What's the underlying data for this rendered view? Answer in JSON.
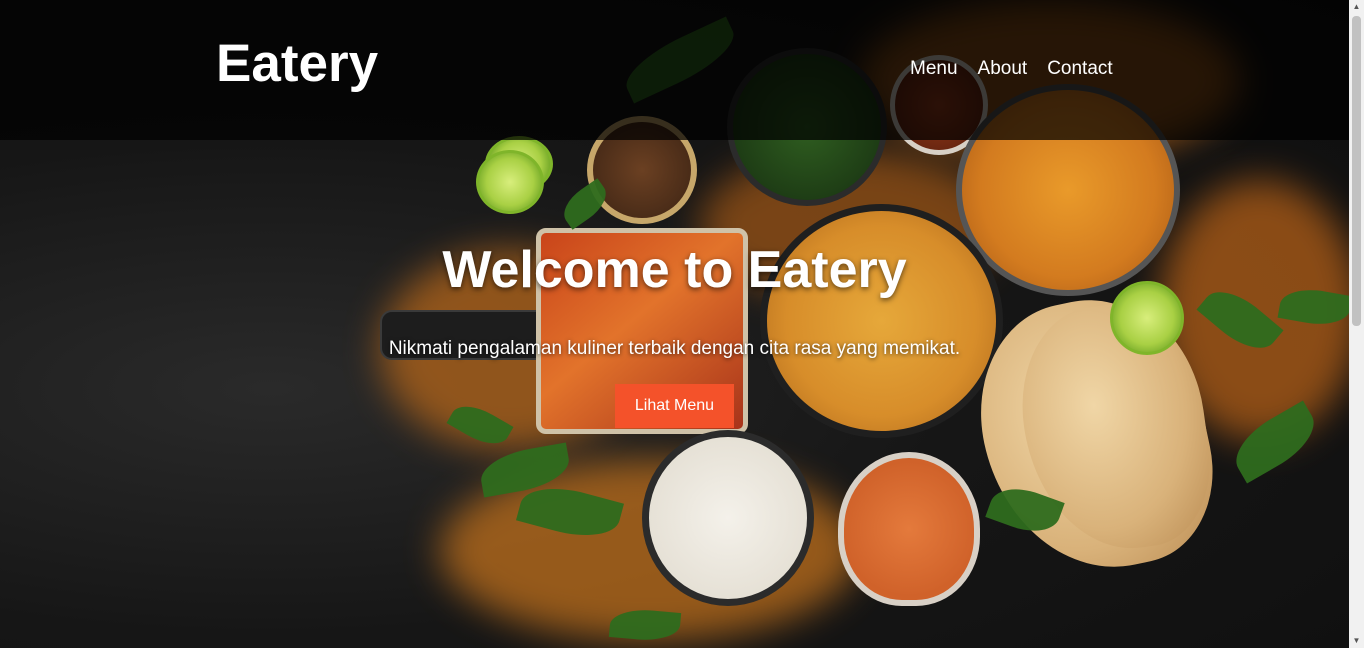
{
  "header": {
    "logo": "Eatery",
    "nav": [
      {
        "label": "Menu"
      },
      {
        "label": "About"
      },
      {
        "label": "Contact"
      }
    ]
  },
  "hero": {
    "title": "Welcome to Eatery",
    "subtitle": "Nikmati pengalaman kuliner terbaik dengan cita rasa yang memikat.",
    "cta_label": "Lihat Menu"
  },
  "colors": {
    "accent": "#f4522a",
    "header_overlay": "rgba(0,0,0,0.72)"
  },
  "icons": {
    "scroll_up": "scroll-up-arrow-icon",
    "scroll_down": "scroll-down-arrow-icon"
  }
}
